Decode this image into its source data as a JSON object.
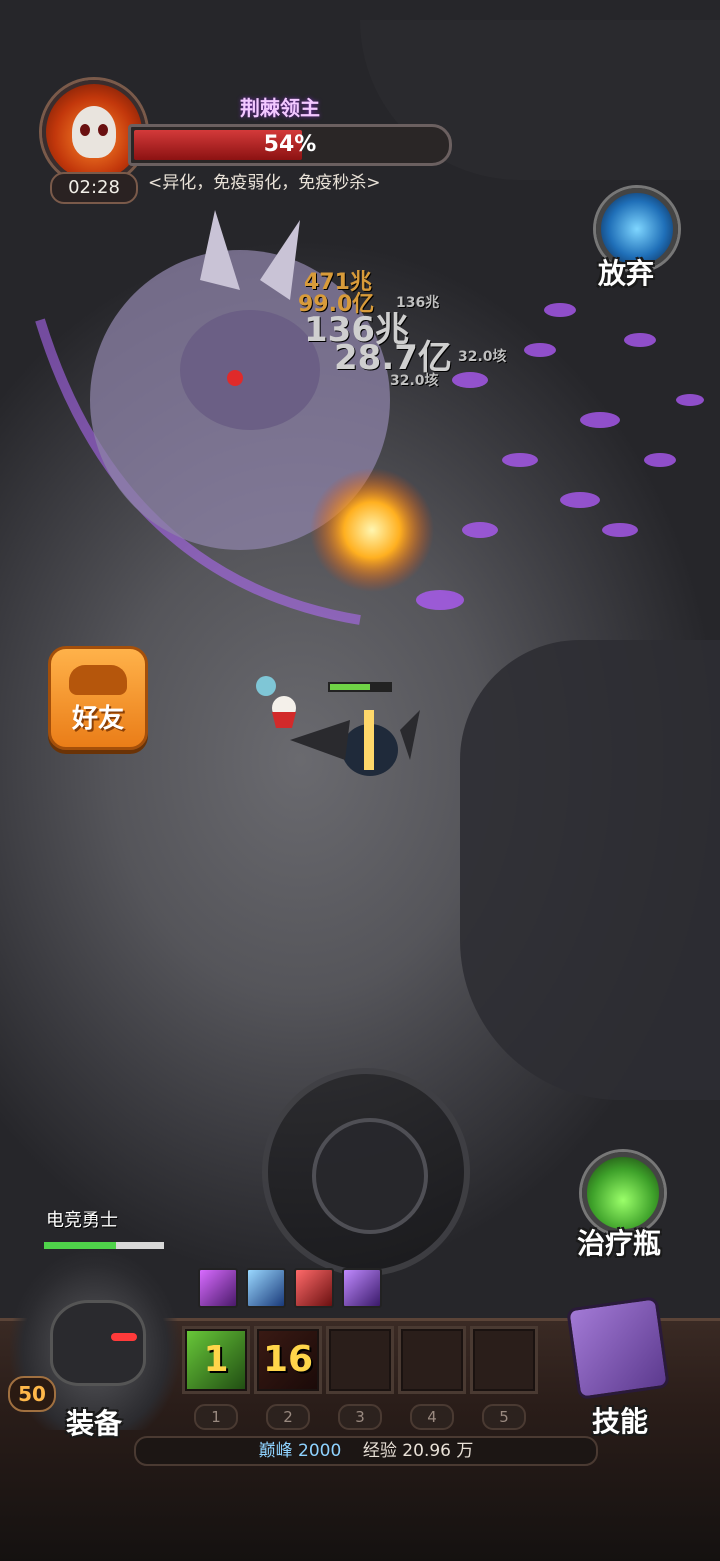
{
  "boss": {
    "name": "荆棘领主",
    "hp_percent_label": "54%",
    "hp_fraction": 0.54,
    "timer": "02:28",
    "traits": "<异化，免疫弱化，免疫秒杀>"
  },
  "buttons": {
    "give_up": "放弃",
    "friends": "好友",
    "heal_potion": "治疗瓶",
    "equipment": "装备",
    "skills": "技能"
  },
  "damage_numbers": [
    "471兆",
    "99.0亿",
    "136兆",
    "136兆",
    "28.7亿",
    "32.0垓",
    "32.0垓"
  ],
  "player": {
    "name": "电竞勇士",
    "level": "50",
    "hp_fraction": 0.6
  },
  "skill_slots": [
    {
      "number": "1",
      "value": "1"
    },
    {
      "number": "2",
      "value": "16"
    },
    {
      "number": "3",
      "value": ""
    },
    {
      "number": "4",
      "value": ""
    },
    {
      "number": "5",
      "value": ""
    }
  ],
  "footer": {
    "peak_label": "巅峰 2000",
    "exp_label": "经验 20.96 万"
  },
  "colors": {
    "boss_hp": "#d33a3a",
    "player_hp": "#4fd34a",
    "friend_button": "#f59a2e"
  }
}
